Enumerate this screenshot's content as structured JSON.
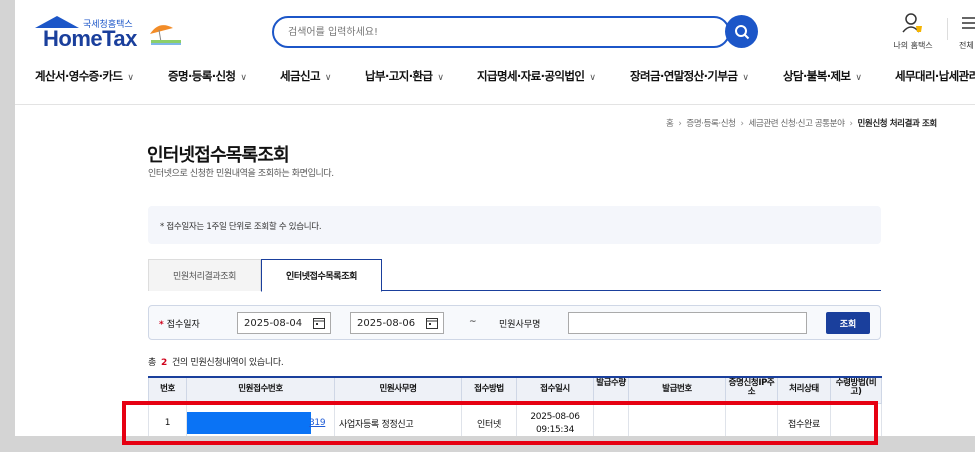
{
  "header": {
    "logo_sub": "국세청홈택스",
    "logo_main": "HomeTax",
    "search_placeholder": "검색어를 입력하세요!",
    "my_hometax": "나의 홈택스",
    "all_menu": "전체"
  },
  "nav": [
    "계산서·영수증·카드",
    "증명·등록·신청",
    "세금신고",
    "납부·고지·환급",
    "지급명세·자료·공익법인",
    "장려금·연말정산·기부금",
    "상담·불복·제보",
    "세무대리·납세관리"
  ],
  "breadcrumb": [
    "홈",
    "증명·등록·신청",
    "세금관련 신청·신고 공통분야",
    "민원신청 처리결과 조회"
  ],
  "page": {
    "title": "인터넷접수목록조회",
    "desc": "인터넷으로 신청한 민원내역을 조회하는 화면입니다.",
    "notice": "* 접수일자는 1주일 단위로 조회할 수 있습니다."
  },
  "tabs": [
    "민원처리결과조회",
    "인터넷접수목록조회"
  ],
  "search": {
    "date_label": "접수일자",
    "date_from": "2025-08-04",
    "date_to": "2025-08-06",
    "tilde": "~",
    "name_label": "민원사무명",
    "name_value": "",
    "button": "조회"
  },
  "result": {
    "prefix": "총",
    "count": "2",
    "suffix": "건의 민원신청내역이 있습니다."
  },
  "table": {
    "headers": [
      "번호",
      "민원접수번호",
      "민원사무명",
      "접수방법",
      "접수일시",
      "발급수량",
      "발급번호",
      "증명신청IP주소",
      "처리상태",
      "수령방법(비고)"
    ],
    "rows": [
      {
        "no": "1",
        "receipt_no_suffix": "319",
        "name": "사업자등록 정정신고",
        "method": "인터넷",
        "date": "2025-08-06",
        "time": "09:15:34",
        "qty": "",
        "issue_no": "",
        "ip": "",
        "status": "접수완료",
        "receive": ""
      }
    ]
  },
  "colors": {
    "brand": "#1a3f9c",
    "accent": "#1c56c8",
    "highlight": "#e60012",
    "mask": "#0a73f5"
  }
}
